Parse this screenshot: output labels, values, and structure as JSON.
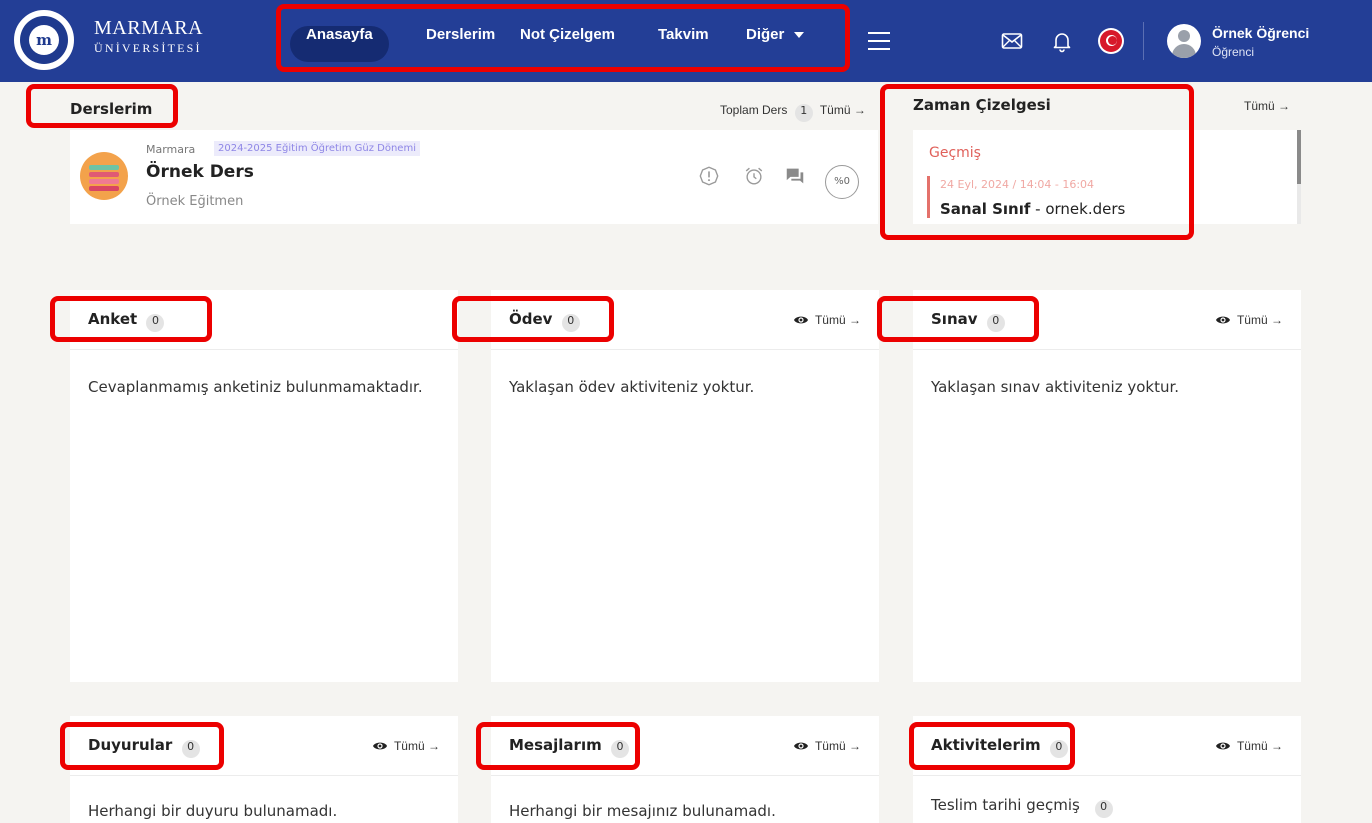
{
  "brand": {
    "name": "MARMARA",
    "subtitle": "ÜNİVERSİTESİ",
    "logo_letter": "m"
  },
  "nav": {
    "items": [
      {
        "label": "Anasayfa",
        "active": true
      },
      {
        "label": "Derslerim",
        "active": false
      },
      {
        "label": "Not Çizelgem",
        "active": false
      },
      {
        "label": "Takvim",
        "active": false
      },
      {
        "label": "Diğer",
        "active": false,
        "has_dropdown": true
      }
    ]
  },
  "header_icons": [
    "menu-icon",
    "mail-icon",
    "bell-icon",
    "turkey-flag-icon"
  ],
  "user": {
    "name": "Örnek Öğrenci",
    "role": "Öğrenci"
  },
  "courses_section": {
    "title": "Derslerim",
    "total_label": "Toplam Ders",
    "total_count": "1",
    "all_link": "Tümü"
  },
  "course": {
    "org": "Marmara",
    "term": "2024-2025 Eğitim Öğretim Güz Dönemi",
    "title": "Örnek Ders",
    "instructor": "Örnek Eğitmen",
    "progress": "%0",
    "progress_value": 0
  },
  "timeline": {
    "title": "Zaman Çizelgesi",
    "all_link": "Tümü",
    "group_label": "Geçmiş",
    "event_date": "24 Eyl, 2024 / 14:04 - 16:04",
    "event_type": "Sanal Sınıf",
    "event_separator": " - ",
    "event_course": "ornek.ders"
  },
  "widgets": {
    "anket": {
      "title": "Anket",
      "count": "0",
      "body": "Cevaplanmamış anketiniz bulunmamaktadır."
    },
    "odev": {
      "title": "Ödev",
      "count": "0",
      "link": "Tümü",
      "body": "Yaklaşan ödev aktiviteniz yoktur."
    },
    "sinav": {
      "title": "Sınav",
      "count": "0",
      "link": "Tümü",
      "body": "Yaklaşan sınav aktiviteniz yoktur."
    },
    "duyurular": {
      "title": "Duyurular",
      "count": "0",
      "link": "Tümü",
      "body": "Herhangi bir duyuru bulunamadı."
    },
    "mesajlarim": {
      "title": "Mesajlarım",
      "count": "0",
      "link": "Tümü",
      "body": "Herhangi bir mesajınız bulunamadı."
    },
    "aktivitelerim": {
      "title": "Aktivitelerim",
      "count": "0",
      "link": "Tümü",
      "body": "Teslim tarihi geçmiş",
      "body_count": "0"
    }
  },
  "colors": {
    "navbar": "#233e96",
    "nav_active": "#152b72",
    "timeline_accent": "#e0605a",
    "term_badge_text": "#8e86e6",
    "annotation": "#ec0000"
  }
}
